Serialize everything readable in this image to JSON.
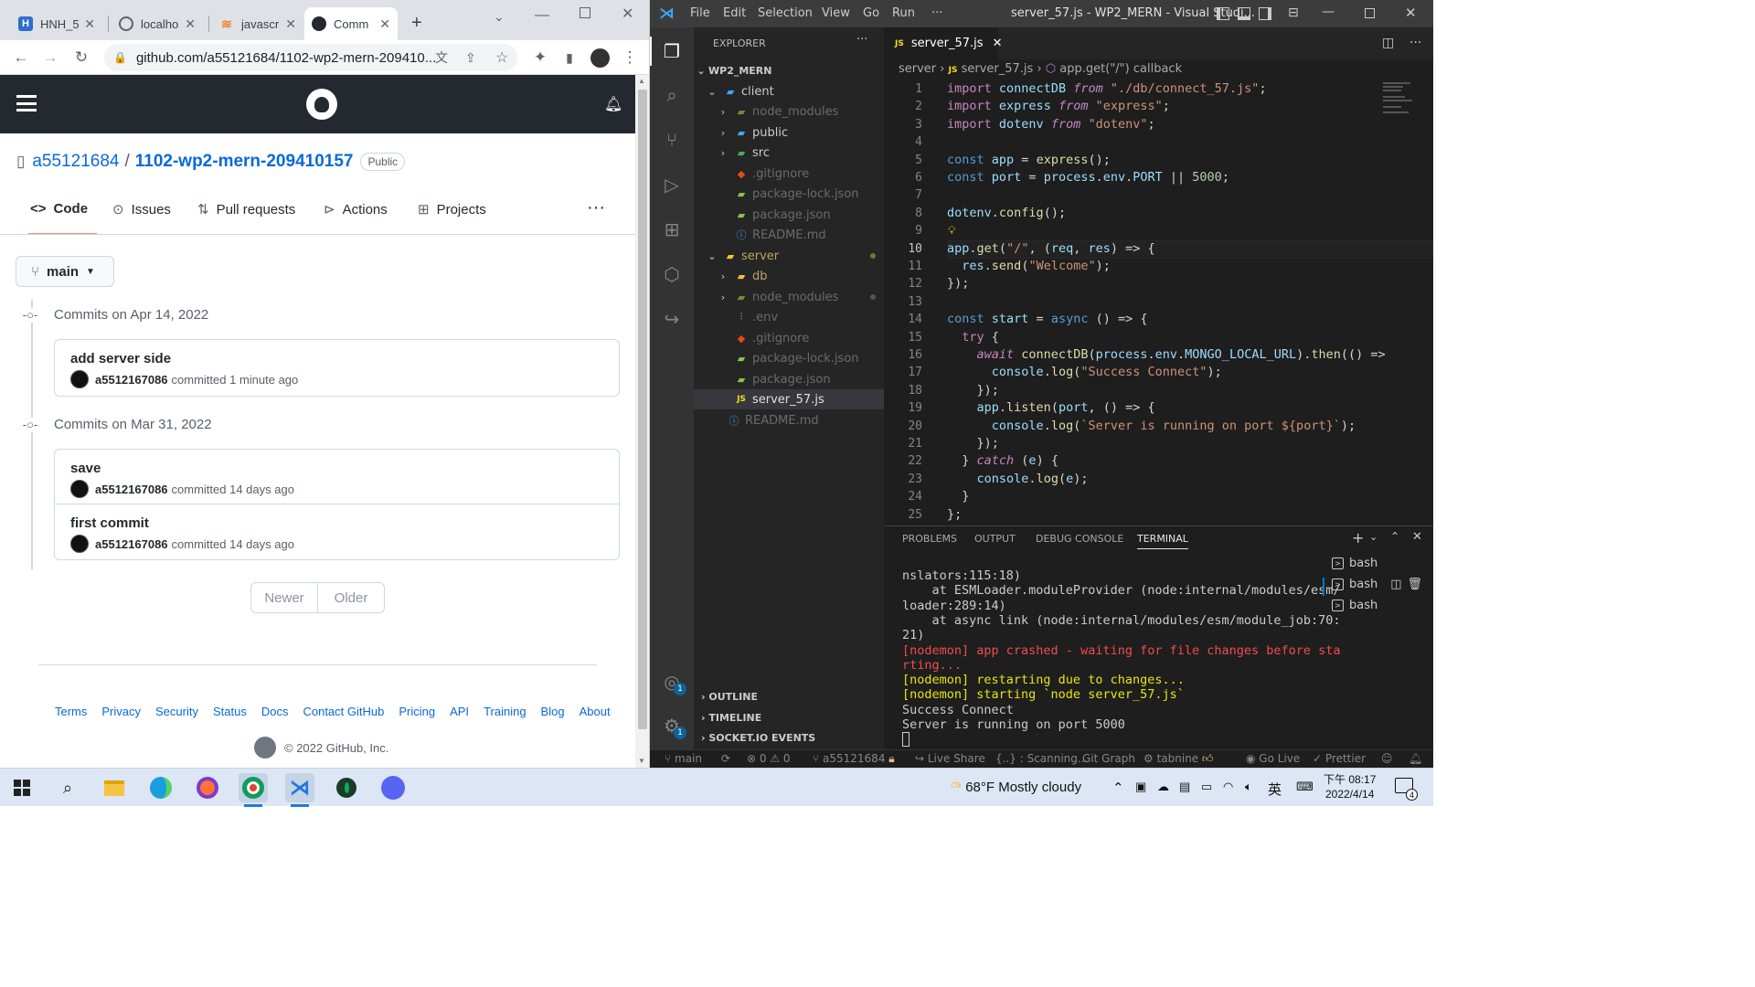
{
  "browser": {
    "tabs": [
      {
        "title": "HNH_5",
        "favicon": "H"
      },
      {
        "title": "localhos",
        "favicon": "globe"
      },
      {
        "title": "javascri",
        "favicon": "so"
      },
      {
        "title": "Comm",
        "favicon": "github",
        "active": true
      }
    ],
    "new_tab": "+",
    "address": "github.com/a55121684/1102-wp2-mern-209410..."
  },
  "github": {
    "owner": "a55121684",
    "separator": "/",
    "repo": "1102-wp2-mern-209410157",
    "visibility": "Public",
    "tabs": [
      "Code",
      "Issues",
      "Pull requests",
      "Actions",
      "Projects"
    ],
    "more": "···",
    "branch": "main",
    "days": [
      {
        "heading": "Commits on Apr 14, 2022",
        "commits": [
          {
            "message": "add server side",
            "user": "a5512167086",
            "when": "committed 1 minute ago"
          }
        ]
      },
      {
        "heading": "Commits on Mar 31, 2022",
        "commits": [
          {
            "message": "save",
            "user": "a5512167086",
            "when": "committed 14 days ago"
          },
          {
            "message": "first commit",
            "user": "a5512167086",
            "when": "committed 14 days ago"
          }
        ]
      }
    ],
    "pager": {
      "newer": "Newer",
      "older": "Older"
    },
    "footer_links": [
      "Terms",
      "Privacy",
      "Security",
      "Status",
      "Docs",
      "Contact GitHub",
      "Pricing",
      "API",
      "Training",
      "Blog",
      "About"
    ],
    "copyright": "© 2022 GitHub, Inc."
  },
  "vscode": {
    "menu": [
      "File",
      "Edit",
      "Selection",
      "View",
      "Go",
      "Run",
      "···"
    ],
    "title": "server_57.js - WP2_MERN - Visual Studi...",
    "explorer": {
      "title": "EXPLORER",
      "root": "WP2_MERN",
      "items": [
        {
          "name": "client"
        },
        {
          "name": "node_modules"
        },
        {
          "name": "public"
        },
        {
          "name": "src"
        },
        {
          "name": ".gitignore"
        },
        {
          "name": "package-lock.json"
        },
        {
          "name": "package.json"
        },
        {
          "name": "README.md"
        },
        {
          "name": "server"
        },
        {
          "name": "db"
        },
        {
          "name": "node_modules"
        },
        {
          "name": ".env"
        },
        {
          "name": ".gitignore"
        },
        {
          "name": "package-lock.json"
        },
        {
          "name": "package.json"
        },
        {
          "name": "server_57.js"
        },
        {
          "name": "README.md"
        }
      ],
      "sections": [
        "OUTLINE",
        "TIMELINE",
        "SOCKET.IO EVENTS"
      ]
    },
    "editor_tab": "server_57.js",
    "breadcrumb": [
      "server",
      "server_57.js",
      "app.get(\"/\") callback"
    ],
    "code_lines": [
      "import connectDB from \"./db/connect_57.js\";",
      "import express from \"express\";",
      "import dotenv from \"dotenv\";",
      "",
      "const app = express();",
      "const port = process.env.PORT || 5000;",
      "",
      "dotenv.config();",
      "",
      "app.get(\"/\", (req, res) => {",
      "  res.send(\"Welcome\");",
      "});",
      "",
      "const start = async () => {",
      "  try {",
      "    await connectDB(process.env.MONGO_LOCAL_URL).then(() =>",
      "      console.log(\"Success Connect\");",
      "    });",
      "    app.listen(port, () => {",
      "      console.log(`Server is running on port ${port}`);",
      "    });",
      "  } catch (e) {",
      "    console.log(e);",
      "  }",
      "};"
    ],
    "panel_tabs": [
      "PROBLEMS",
      "OUTPUT",
      "DEBUG CONSOLE",
      "TERMINAL"
    ],
    "terminal_lines": [
      {
        "text": "nslators:115:18)",
        "color": "normal"
      },
      {
        "text": "    at ESMLoader.moduleProvider (node:internal/modules/esm/",
        "color": "normal"
      },
      {
        "text": "loader:289:14)",
        "color": "normal"
      },
      {
        "text": "    at async link (node:internal/modules/esm/module_job:70:",
        "color": "normal"
      },
      {
        "text": "21)",
        "color": "normal"
      },
      {
        "text": "[nodemon] app crashed - waiting for file changes before sta",
        "color": "red"
      },
      {
        "text": "rting...",
        "color": "red"
      },
      {
        "text": "[nodemon] restarting due to changes...",
        "color": "yellow"
      },
      {
        "text": "[nodemon] starting `node server_57.js`",
        "color": "yellow"
      },
      {
        "text": "Success Connect",
        "color": "normal"
      },
      {
        "text": "Server is running on port 5000",
        "color": "normal"
      }
    ],
    "terminals": [
      "bash",
      "bash",
      "bash"
    ],
    "status": {
      "branch": "main",
      "problems": "⊗ 0 ⚠ 0",
      "user": "a55121684",
      "live_share": "Live Share",
      "scanning": "{..} : Scanning...",
      "git_graph": "Git Graph",
      "tabnine": "tabnine",
      "go_live": "Go Live",
      "prettier": "Prettier"
    }
  },
  "taskbar": {
    "weather": "68°F  Mostly cloudy",
    "ime": "英",
    "time": "下午 08:17",
    "date": "2022/4/14",
    "notifications": "4"
  }
}
